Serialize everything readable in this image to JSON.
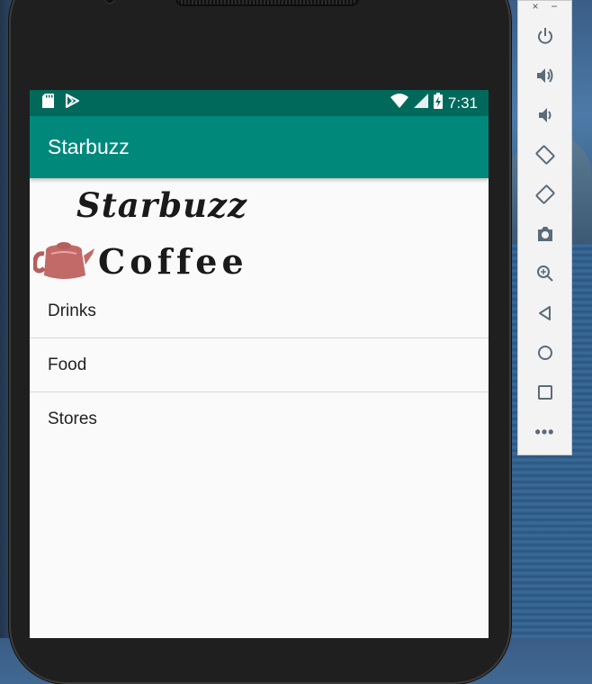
{
  "app": {
    "title": "Starbuzz"
  },
  "status_bar": {
    "time": "7:31",
    "icons": [
      "sd-card-icon",
      "play-store-icon",
      "wifi-icon",
      "cell-signal-icon",
      "battery-charging-icon"
    ]
  },
  "logo": {
    "line1": "Starbuzz",
    "line2": "Coffee",
    "icon": "teapot-icon"
  },
  "nav": {
    "items": [
      {
        "label": "Drinks"
      },
      {
        "label": "Food"
      },
      {
        "label": "Stores"
      }
    ]
  },
  "emulator": {
    "close_label": "×",
    "minimize_label": "−",
    "controls": [
      "power-icon",
      "volume-up-icon",
      "volume-down-icon",
      "rotate-left-icon",
      "rotate-right-icon",
      "camera-icon",
      "zoom-icon",
      "back-icon",
      "home-icon",
      "overview-icon",
      "more-icon"
    ],
    "more_label": "•••"
  },
  "colors": {
    "status_bar": "#00695c",
    "app_bar": "#00897b",
    "background": "#fafafa"
  }
}
